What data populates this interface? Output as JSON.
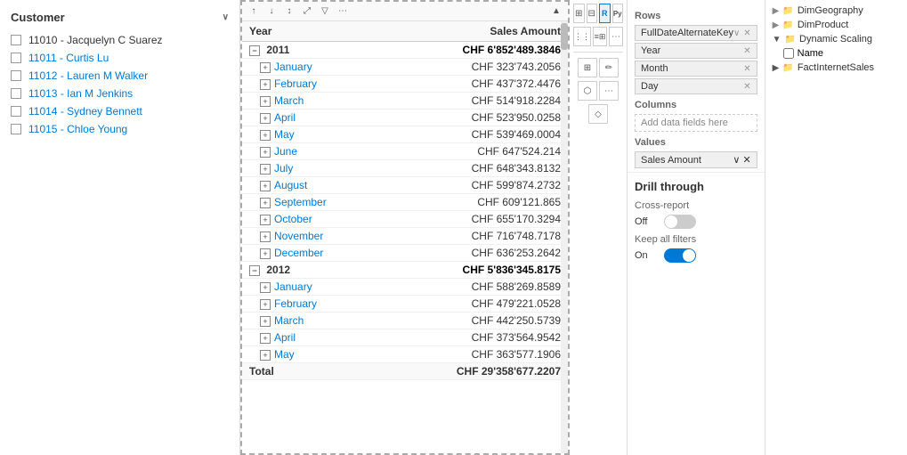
{
  "leftPanel": {
    "title": "Customer",
    "customers": [
      {
        "id": "11010",
        "name": "Jacquelyn C Suarez",
        "checked": false
      },
      {
        "id": "11011",
        "name": "Curtis Lu",
        "checked": false
      },
      {
        "id": "11012",
        "name": "Lauren M Walker",
        "checked": false
      },
      {
        "id": "11013",
        "name": "Ian M Jenkins",
        "checked": false
      },
      {
        "id": "11014",
        "name": "Sydney Bennett",
        "checked": false
      },
      {
        "id": "11015",
        "name": "Chloe Young",
        "checked": false
      }
    ]
  },
  "matrix": {
    "columns": [
      "Year",
      "Sales Amount"
    ],
    "rows": [
      {
        "type": "year",
        "label": "2011",
        "amount": "CHF 6'852'489.3846",
        "expandable": true
      },
      {
        "type": "month",
        "label": "January",
        "amount": "CHF 323'743.2056"
      },
      {
        "type": "month",
        "label": "February",
        "amount": "CHF 437'372.4476"
      },
      {
        "type": "month",
        "label": "March",
        "amount": "CHF 514'918.2284"
      },
      {
        "type": "month",
        "label": "April",
        "amount": "CHF 523'950.0258"
      },
      {
        "type": "month",
        "label": "May",
        "amount": "CHF 539'469.0004"
      },
      {
        "type": "month",
        "label": "June",
        "amount": "CHF 647'524.214"
      },
      {
        "type": "month",
        "label": "July",
        "amount": "CHF 648'343.8132"
      },
      {
        "type": "month",
        "label": "August",
        "amount": "CHF 599'874.2732"
      },
      {
        "type": "month",
        "label": "September",
        "amount": "CHF 609'121.865"
      },
      {
        "type": "month",
        "label": "October",
        "amount": "CHF 655'170.3294"
      },
      {
        "type": "month",
        "label": "November",
        "amount": "CHF 716'748.7178"
      },
      {
        "type": "month",
        "label": "December",
        "amount": "CHF 636'253.2642"
      },
      {
        "type": "year",
        "label": "2012",
        "amount": "CHF 5'836'345.8175",
        "expandable": true
      },
      {
        "type": "month",
        "label": "January",
        "amount": "CHF 588'269.8589"
      },
      {
        "type": "month",
        "label": "February",
        "amount": "CHF 479'221.0528"
      },
      {
        "type": "month",
        "label": "March",
        "amount": "CHF 442'250.5739"
      },
      {
        "type": "month",
        "label": "April",
        "amount": "CHF 373'564.9542"
      },
      {
        "type": "month",
        "label": "May",
        "amount": "CHF 363'577.1906"
      }
    ],
    "total": {
      "label": "Total",
      "amount": "CHF 29'358'677.2207"
    }
  },
  "rightToolbar": {
    "buttons": [
      {
        "icon": "⊞",
        "label": "table",
        "active": false
      },
      {
        "icon": "⚙",
        "label": "format",
        "active": false
      },
      {
        "icon": "R",
        "label": "r-icon",
        "active": true
      },
      {
        "icon": "Py",
        "label": "py-icon",
        "active": false
      },
      {
        "icon": "⋮⋮",
        "label": "grid1",
        "active": false
      },
      {
        "icon": "≡⊞",
        "label": "grid2",
        "active": false
      },
      {
        "icon": "⋯",
        "label": "more",
        "active": false
      },
      {
        "icon": "⊞",
        "label": "matrix",
        "active": false
      },
      {
        "icon": "✏",
        "label": "edit",
        "active": false
      },
      {
        "icon": "⬡",
        "label": "hex",
        "active": false
      },
      {
        "icon": "⋯",
        "label": "more2",
        "active": false
      },
      {
        "icon": "◇",
        "label": "diamond",
        "active": false
      }
    ]
  },
  "fieldsPanel": {
    "rowsLabel": "Rows",
    "rowsFields": [
      {
        "name": "FullDateAlternateKey",
        "hasChevron": true,
        "hasX": true
      },
      {
        "name": "Year",
        "hasChevron": false,
        "hasX": true
      },
      {
        "name": "Month",
        "hasChevron": false,
        "hasX": true
      },
      {
        "name": "Day",
        "hasChevron": false,
        "hasX": true
      }
    ],
    "columnsLabel": "Columns",
    "columnsPlaceholder": "Add data fields here",
    "valuesLabel": "Values",
    "valuesFields": [
      {
        "name": "Sales Amount",
        "hasChevron": true,
        "hasX": true
      }
    ]
  },
  "drillThrough": {
    "title": "Drill through",
    "crossReportLabel": "Cross-report",
    "offLabel": "Off",
    "keepFiltersLabel": "Keep all filters",
    "onLabel": "On"
  },
  "treePanel": {
    "items": [
      {
        "label": "DimGeography",
        "type": "folder",
        "expanded": false
      },
      {
        "label": "DimProduct",
        "type": "folder",
        "expanded": false
      },
      {
        "label": "Dynamic Scaling",
        "type": "folder",
        "expanded": true
      },
      {
        "label": "Name",
        "type": "checkbox",
        "checked": false,
        "indent": true
      },
      {
        "label": "FactInternetSales",
        "type": "folder",
        "expanded": false,
        "indent": false
      }
    ]
  }
}
